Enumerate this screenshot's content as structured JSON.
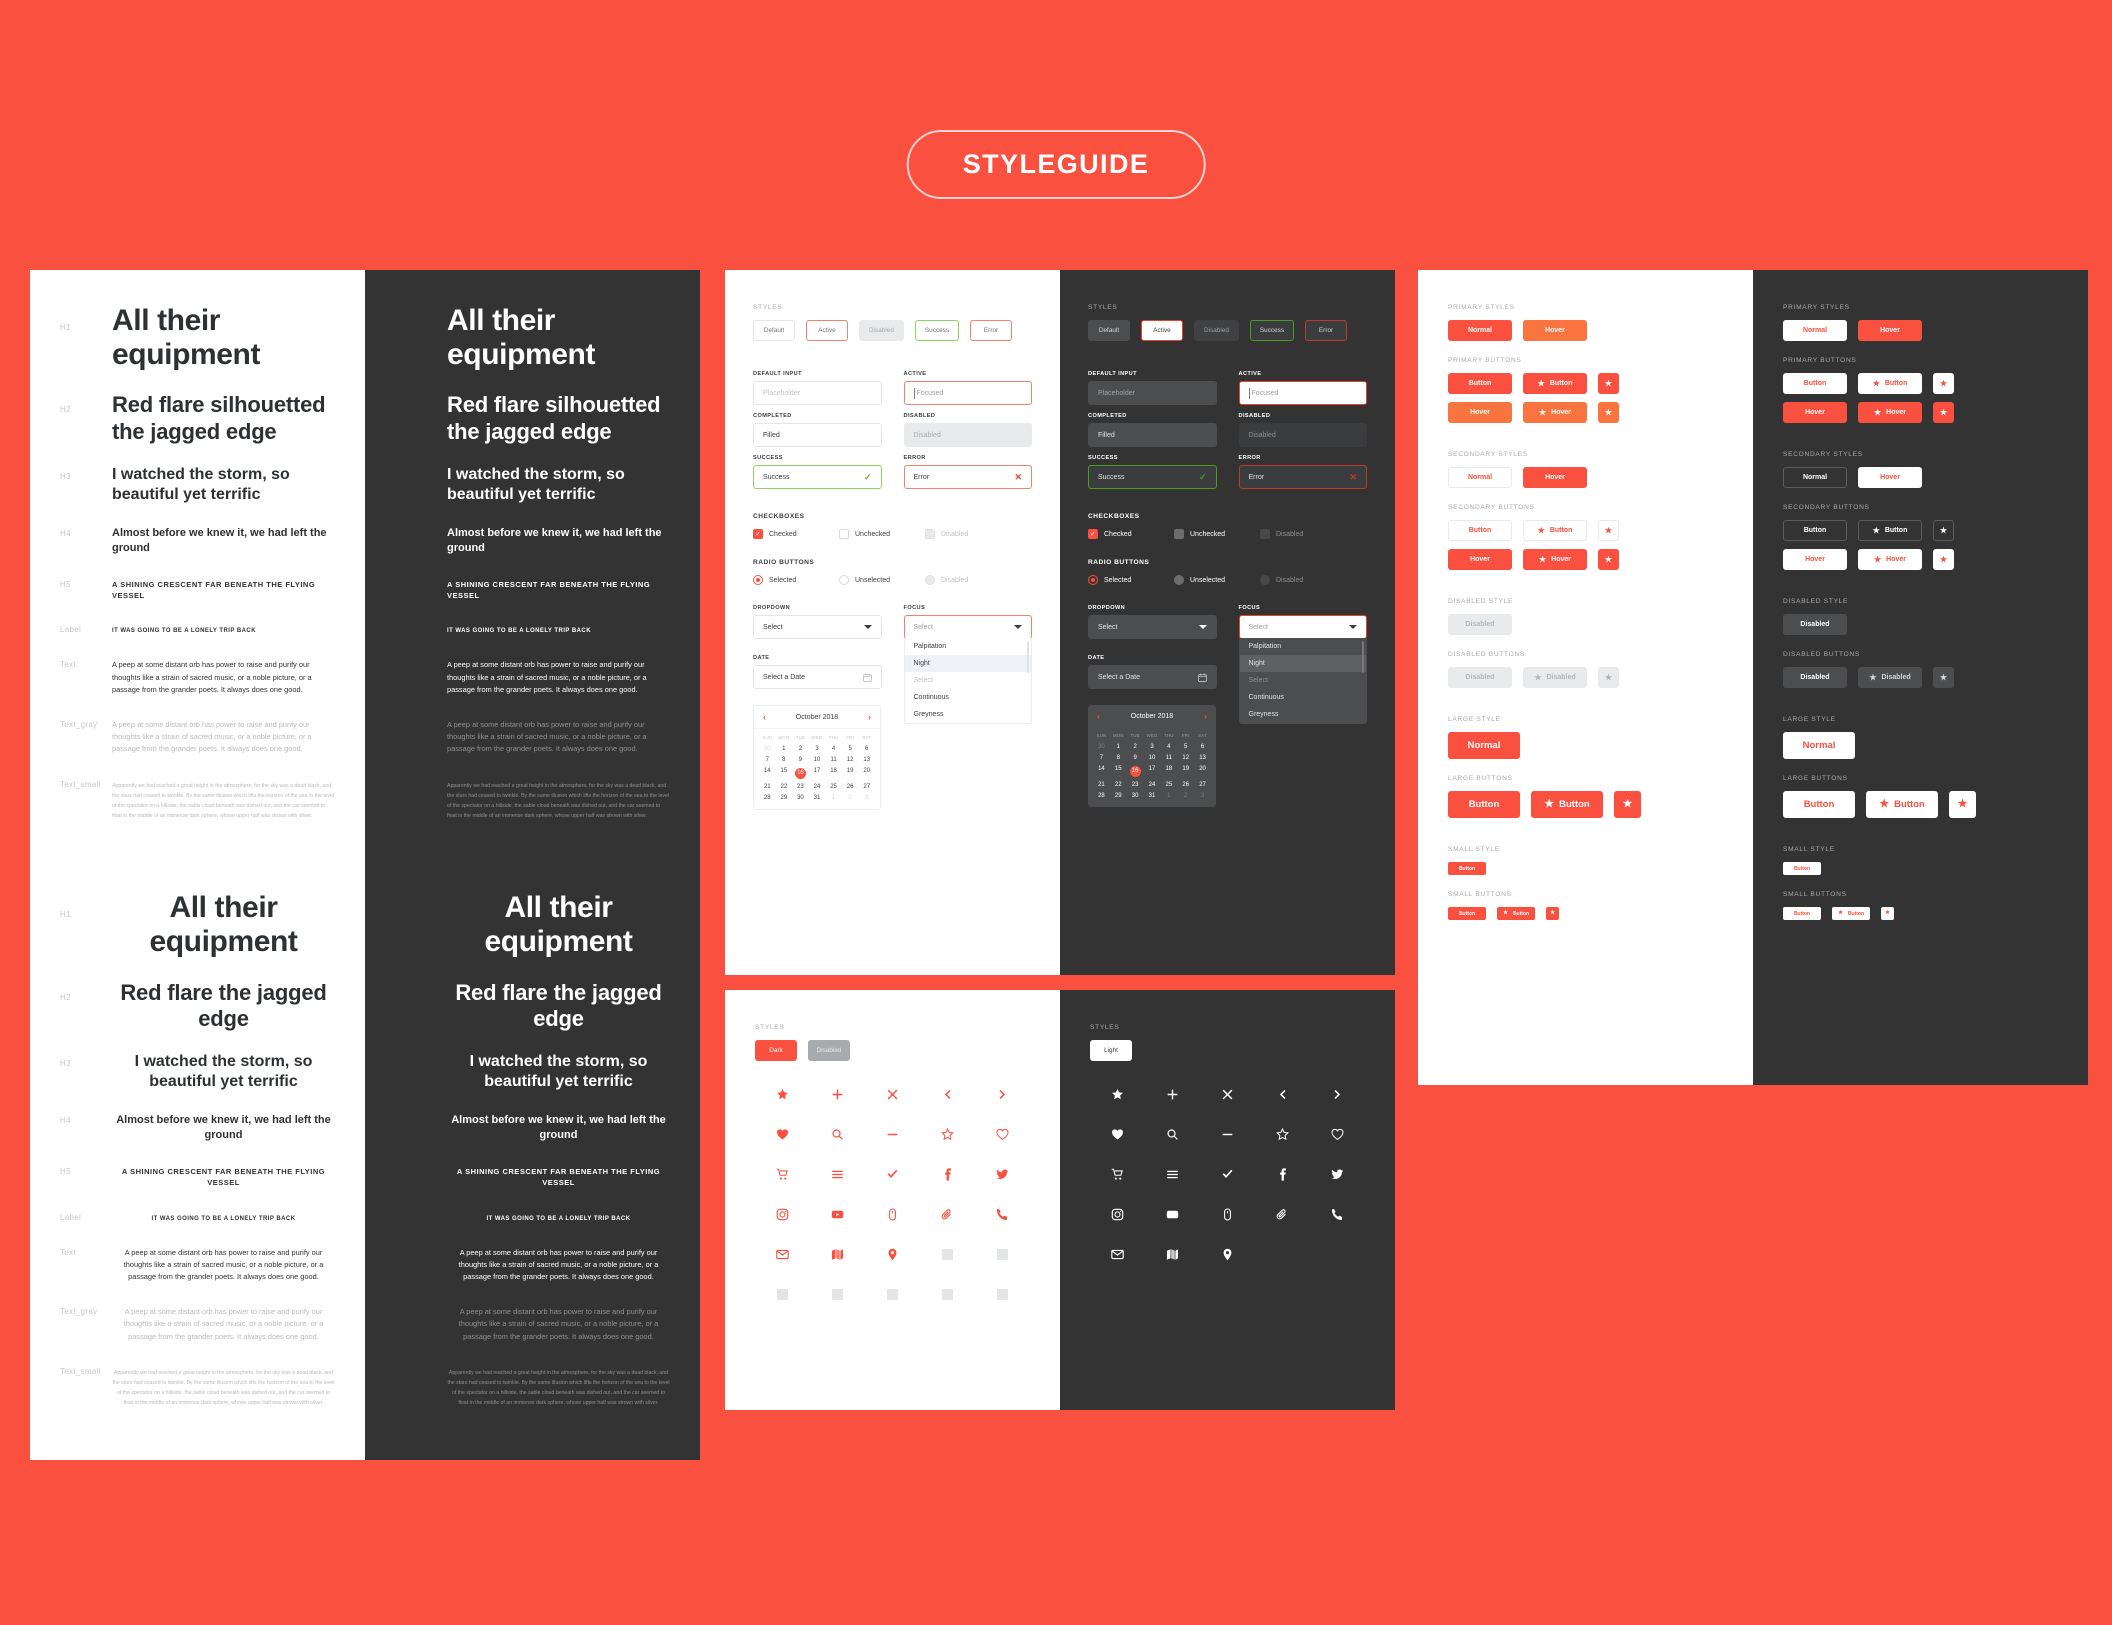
{
  "header": {
    "title": "STYLEGUIDE"
  },
  "colors": {
    "background": "#f9503f",
    "accent": "#f9503f",
    "accent_hover": "#fa7440",
    "dark_panel": "#333333",
    "success": "#8ed661",
    "error": "#f4806f",
    "text_dark": "#2e3133",
    "text_gray": "#b7babd"
  },
  "typography": {
    "tags": {
      "h1": "H1",
      "h2": "H2",
      "h3": "H3",
      "h4": "H4",
      "h5": "H5",
      "label": "Label",
      "text": "Text",
      "text_gray": "Text_gray",
      "text_small": "Text_small"
    },
    "left": {
      "h1": "All their equipment",
      "h2": "Red flare silhouetted the jagged edge",
      "h3": "I watched the storm, so beautiful yet terrific",
      "h4": "Almost before we knew it, we had left the ground",
      "h5": "A SHINING CRESCENT FAR BENEATH THE FLYING VESSEL",
      "label": "IT WAS GOING TO BE A LONELY TRIP BACK",
      "text": "A peep at some distant orb has power to raise and purify our thoughts like a strain of sacred music, or a noble picture, or a passage from the grander poets. It always does one good.",
      "text_gray": "A peep at some distant orb has power to raise and purify our thoughts like a strain of sacred music, or a noble picture, or a passage from the grander poets. It always does one good.",
      "text_small": "Apparently we had reached a great height in the atmosphere, for the sky was a dead black, and the stars had ceased to twinkle. By the same illusion which lifts the horizon of the sea to the level of the spectator on a hillside, the sable cloud beneath was dished out, and the car seemed to float in the middle of an immense dark sphere, whose upper half was strown with silver."
    },
    "center": {
      "h1": "All their equipment",
      "h2": "Red flare the jagged edge",
      "h3": "I watched the storm, so beautiful yet terrific",
      "h4": "Almost before we knew it, we had left the ground",
      "h5": "A SHINING CRESCENT FAR BENEATH THE FLYING VESSEL",
      "label": "IT WAS GOING TO BE A LONELY TRIP BACK",
      "text": "A peep at some distant orb has power to raise and purify our thoughts like a strain of sacred music, or a noble picture, or a passage from the grander poets. It always does one good.",
      "text_gray": "A peep at some distant orb has power to raise and purify our thoughts like a strain of sacred music, or a noble picture, or a passage from the grander poets. It always does one good.",
      "text_small": "Apparently we had reached a great height in the atmosphere, for the sky was a dead black, and the stars had ceased to twinkle. By the same illusion which lifts the horizon of the sea to the level of the spectator on a hillside, the sable cloud beneath was dished out, and the car seemed to float in the middle of an immense dark sphere, whose upper half was strown with silver."
    }
  },
  "forms": {
    "styles_label": "STYLES",
    "chips": [
      "Default",
      "Active",
      "Disabled",
      "Success",
      "Error"
    ],
    "fields": {
      "default_input": {
        "label": "DEFAULT INPUT",
        "value": "Placeholder"
      },
      "active": {
        "label": "ACTIVE",
        "value": "Focused"
      },
      "completed": {
        "label": "COMPLETED",
        "value": "Filled"
      },
      "disabled": {
        "label": "DISABLED",
        "value": "Disabled"
      },
      "success": {
        "label": "SUCCESS",
        "value": "Success",
        "icon": "check-icon"
      },
      "error": {
        "label": "ERROR",
        "value": "Error",
        "icon": "cross-icon"
      }
    },
    "checkboxes": {
      "label": "CHECKBOXES",
      "options": [
        "Checked",
        "Unchecked",
        "Disabled"
      ]
    },
    "radios": {
      "label": "RADIO BUTTONS",
      "options": [
        "Selected",
        "Unselected",
        "Disabled"
      ]
    },
    "dropdown": {
      "label": "DROPDOWN",
      "value": "Select"
    },
    "focus": {
      "label": "FOCUS",
      "value": "Select",
      "options": [
        "Palpitation",
        "Night",
        "Select",
        "Continuous",
        "Greyness"
      ],
      "highlighted": "Night",
      "disabled_option": "Select"
    },
    "date": {
      "label": "DATE",
      "value": "Select a Date"
    },
    "calendar": {
      "month": "October 2018",
      "prev": "‹",
      "next": "›",
      "dow": [
        "SUN",
        "MON",
        "TUE",
        "WED",
        "THU",
        "FRI",
        "SAT"
      ],
      "weeks": [
        [
          {
            "d": "30",
            "out": true
          },
          {
            "d": "1"
          },
          {
            "d": "2"
          },
          {
            "d": "3"
          },
          {
            "d": "4"
          },
          {
            "d": "5"
          },
          {
            "d": "6"
          }
        ],
        [
          {
            "d": "7"
          },
          {
            "d": "8"
          },
          {
            "d": "9"
          },
          {
            "d": "10"
          },
          {
            "d": "11"
          },
          {
            "d": "12"
          },
          {
            "d": "13"
          }
        ],
        [
          {
            "d": "14"
          },
          {
            "d": "15"
          },
          {
            "d": "16",
            "sel": true
          },
          {
            "d": "17"
          },
          {
            "d": "18"
          },
          {
            "d": "19"
          },
          {
            "d": "20"
          }
        ],
        [
          {
            "d": "21"
          },
          {
            "d": "22"
          },
          {
            "d": "23"
          },
          {
            "d": "24"
          },
          {
            "d": "25"
          },
          {
            "d": "26"
          },
          {
            "d": "27"
          }
        ],
        [
          {
            "d": "28"
          },
          {
            "d": "29"
          },
          {
            "d": "30"
          },
          {
            "d": "31"
          },
          {
            "d": "1",
            "out": true
          },
          {
            "d": "2",
            "out": true
          },
          {
            "d": "3",
            "out": true
          }
        ]
      ],
      "selected_day": "16"
    }
  },
  "buttons": {
    "sections": {
      "primary_styles": "PRIMARY STYLES",
      "primary_buttons": "PRIMARY BUTTONS",
      "secondary_styles": "SECONDARY STYLES",
      "secondary_buttons": "SECONDARY BUTTONS",
      "disabled_style": "DISABLED STYLE",
      "disabled_buttons": "DISABLED BUTTONS",
      "large_style": "LARGE STYLE",
      "large_buttons": "LARGE BUTTONS",
      "small_style": "SMALL STYLE",
      "small_buttons": "SMALL BUTTONS"
    },
    "labels": {
      "normal": "Normal",
      "hover": "Hover",
      "button": "Button",
      "disabled": "Disabled"
    },
    "star_icon": "star-icon"
  },
  "icons_panel": {
    "styles_label": "STYLES",
    "light_chips": [
      "Dark",
      "Disabled"
    ],
    "dark_chips": [
      "Light"
    ],
    "names": [
      "star-filled-icon",
      "plus-icon",
      "close-icon",
      "chevron-left-icon",
      "chevron-right-icon",
      "heart-filled-icon",
      "search-icon",
      "minus-icon",
      "star-outline-icon",
      "heart-outline-icon",
      "cart-icon",
      "menu-icon",
      "check-icon",
      "facebook-icon",
      "twitter-icon",
      "instagram-icon",
      "youtube-icon",
      "mouse-icon",
      "paperclip-icon",
      "phone-icon",
      "mail-icon",
      "map-icon",
      "pin-icon",
      "placeholder-icon",
      "placeholder-icon",
      "placeholder-icon",
      "placeholder-icon",
      "placeholder-icon",
      "placeholder-icon",
      "placeholder-icon"
    ]
  }
}
